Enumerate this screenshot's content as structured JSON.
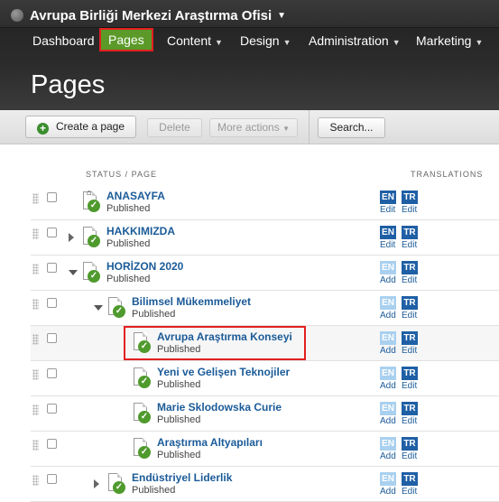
{
  "site": {
    "name": "Avrupa Birliği Merkezi Araştırma Ofisi"
  },
  "nav": {
    "items": [
      "Dashboard",
      "Pages",
      "Content",
      "Design",
      "Administration",
      "Marketing"
    ]
  },
  "page_title": "Pages",
  "toolbar": {
    "create": "Create a page",
    "delete": "Delete",
    "more": "More actions",
    "search": "Search..."
  },
  "columns": {
    "status_page": "STATUS / PAGE",
    "translations": "TRANSLATIONS"
  },
  "rows": [
    {
      "name": "ANASAYFA",
      "status": "Published",
      "en": "EN",
      "en_action": "Edit",
      "tr": "TR",
      "tr_action": "Edit"
    },
    {
      "name": "HAKKIMIZDA",
      "status": "Published",
      "en": "EN",
      "en_action": "Edit",
      "tr": "TR",
      "tr_action": "Edit"
    },
    {
      "name": "HORİZON 2020",
      "status": "Published",
      "en": "EN",
      "en_action": "Add",
      "tr": "TR",
      "tr_action": "Edit"
    },
    {
      "name": "Bilimsel Mükemmeliyet",
      "status": "Published",
      "en": "EN",
      "en_action": "Add",
      "tr": "TR",
      "tr_action": "Edit"
    },
    {
      "name": "Avrupa Araştırma Konseyi",
      "status": "Published",
      "en": "EN",
      "en_action": "Add",
      "tr": "TR",
      "tr_action": "Edit"
    },
    {
      "name": "Yeni ve Gelişen Teknojiler",
      "status": "Published",
      "en": "EN",
      "en_action": "Add",
      "tr": "TR",
      "tr_action": "Edit"
    },
    {
      "name": "Marie Sklodowska Curie",
      "status": "Published",
      "en": "EN",
      "en_action": "Add",
      "tr": "TR",
      "tr_action": "Edit"
    },
    {
      "name": "Araştırma Altyapıları",
      "status": "Published",
      "en": "EN",
      "en_action": "Add",
      "tr": "TR",
      "tr_action": "Edit"
    },
    {
      "name": "Endüstriyel Liderlik",
      "status": "Published",
      "en": "EN",
      "en_action": "Add",
      "tr": "TR",
      "tr_action": "Edit"
    }
  ],
  "icons": {
    "globe": "globe-icon",
    "home": "home-icon",
    "published": "check-circle-icon",
    "drag": "drag-handle-icon",
    "add": "plus-circle-icon"
  },
  "colors": {
    "active_nav": "#5b9a28",
    "highlight": "#e32020",
    "link": "#1b5b98",
    "lang_active": "#1f5fa5",
    "lang_missing": "#a9d0ef",
    "published": "#4f9a2d"
  }
}
